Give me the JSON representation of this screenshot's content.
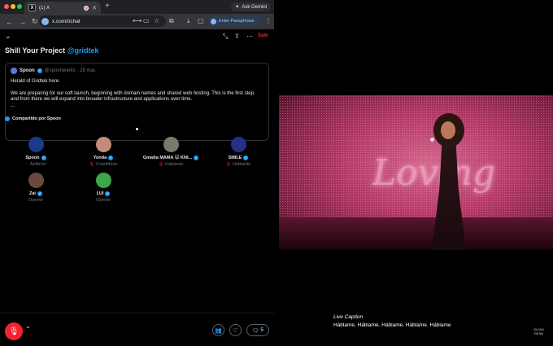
{
  "browser": {
    "tab": {
      "icon": "x-logo-icon",
      "title": "(1) X"
    },
    "gemini_button": "Ask Gemini",
    "url": "x.com/i/chat",
    "passphrase_button": "Enter Passphrase"
  },
  "space": {
    "leave_label": "Salir",
    "title_prefix": "Shill Your Project ",
    "title_hashtag": "@gridtek",
    "pinned": {
      "author": "Spoon",
      "handle_date": "@spoonwerks · 28 mar.",
      "paragraph1": "Herald of Gridtek here.",
      "paragraph2": "We are preparing for our soft launch, beginning with domain names and shared web hosting. This is the first step, and from there we will expand into broader infrastructure and applications over time.",
      "ellipsis": "..."
    },
    "shared_by": "Compartido por Spoon",
    "participants": [
      {
        "name": "Spoon",
        "role": "Anfitrión",
        "avatar_color": "#1b3a8a"
      },
      {
        "name": "Yonda",
        "role": "Coanfitrión",
        "avatar_color": "#c58a7a"
      },
      {
        "name": "Gmatta MAMA 🙀 KNI...",
        "role": "Hablante",
        "avatar_color": "#7a7a6a"
      },
      {
        "name": "SMILE",
        "role": "Hablante",
        "avatar_color": "#2a2e8a"
      },
      {
        "name": "Zai",
        "role": "Oyente",
        "avatar_color": "#6a4a3a"
      },
      {
        "name": "LUI",
        "role": "Oyente",
        "avatar_color": "#3ea64a"
      }
    ],
    "reply_count": "5"
  },
  "video": {
    "neon_sign": "Loving",
    "caption_label": "Live Caption",
    "caption_text": "Háblame. Háblame. Háblame. Háblame. Háblame",
    "watermark_line1": "OLIVIA",
    "watermark_line2": "DEAN"
  },
  "colors": {
    "accent_blue": "#1d9bf0",
    "danger_red": "#f4212e",
    "stage_pink": "#b53a68"
  }
}
